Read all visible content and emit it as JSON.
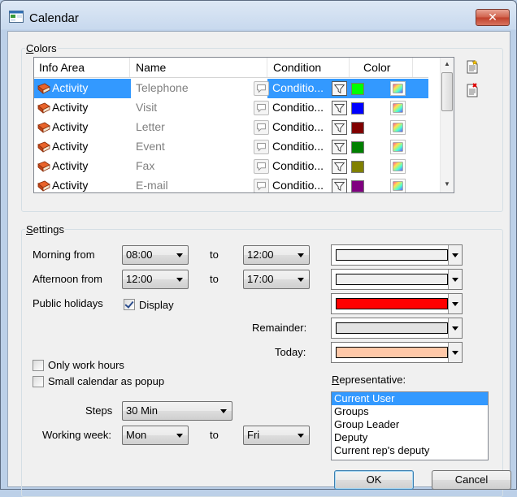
{
  "window": {
    "title": "Calendar",
    "close_glyph": "✕"
  },
  "colors_group": {
    "label_first": "C",
    "label_rest": "olors",
    "columns": [
      "Info Area",
      "Name",
      "Condition",
      "Color"
    ],
    "rows": [
      {
        "area": "Activity",
        "name": "Telephone",
        "condition": "Conditio...",
        "color": "#00ff00",
        "selected": true
      },
      {
        "area": "Activity",
        "name": "Visit",
        "condition": "Conditio...",
        "color": "#0000ff",
        "selected": false
      },
      {
        "area": "Activity",
        "name": "Letter",
        "condition": "Conditio...",
        "color": "#800000",
        "selected": false
      },
      {
        "area": "Activity",
        "name": "Event",
        "condition": "Conditio...",
        "color": "#008000",
        "selected": false
      },
      {
        "area": "Activity",
        "name": "Fax",
        "condition": "Conditio...",
        "color": "#808000",
        "selected": false
      },
      {
        "area": "Activity",
        "name": "E-mail",
        "condition": "Conditio...",
        "color": "#800080",
        "selected": false
      }
    ],
    "scroll_up_glyph": "▲",
    "scroll_down_glyph": "▼"
  },
  "settings_group": {
    "label_first": "S",
    "label_rest": "ettings",
    "morning_label": "Morning from",
    "morning_from": "08:00",
    "morning_to": "12:00",
    "afternoon_label": "Afternoon from",
    "afternoon_from": "12:00",
    "afternoon_to": "17:00",
    "to_label": "to",
    "public_holidays_label": "Public holidays",
    "display_label": "Display",
    "display_checked": true,
    "remainder_label": "Remainder:",
    "today_label": "Today:",
    "only_work_hours_label": "Only work hours",
    "small_calendar_label": "Small calendar as popup",
    "steps_label": "Steps",
    "steps_value": "30 Min",
    "working_week_label": "Working week:",
    "week_from": "Mon",
    "week_to": "Fri",
    "representative_label_first": "R",
    "representative_label_rest": "epresentative:",
    "representatives": [
      "Current User",
      "Groups",
      "Group Leader",
      "Deputy",
      "Current rep's deputy"
    ],
    "representative_selected": "Current User",
    "colors": {
      "morning": "#f0f0f0",
      "afternoon": "#f0f0f0",
      "public_holidays": "#ff0000",
      "remainder": "#e2e2e2",
      "today": "#ffc8a8"
    }
  },
  "buttons": {
    "ok": "OK",
    "cancel": "Cancel"
  },
  "icons": {
    "row_area": "book-icon",
    "row_name": "speech-bubble-icon",
    "row_condition": "filter-icon",
    "row_color": "color-picker-icon",
    "side_new": "new-document-icon",
    "side_delete": "delete-document-icon"
  }
}
